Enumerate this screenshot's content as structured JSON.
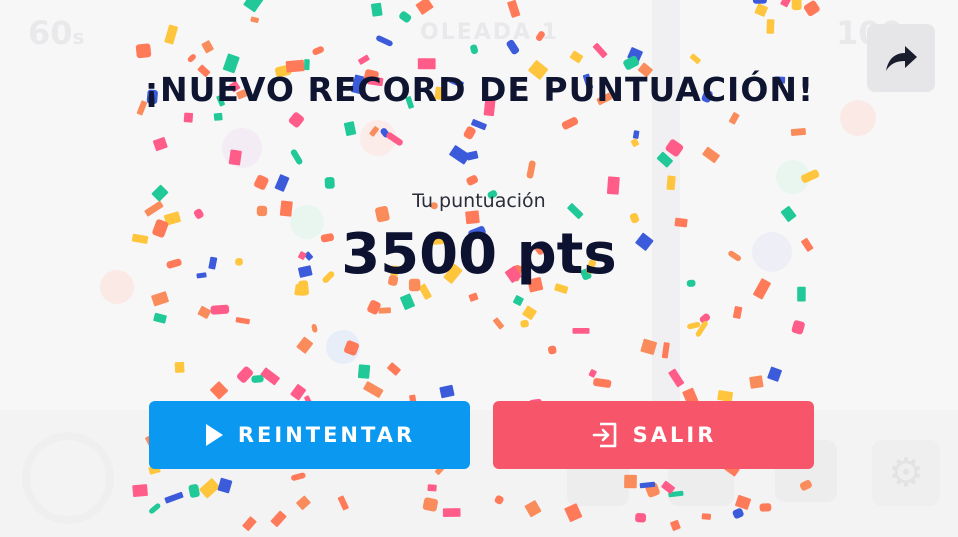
{
  "background_hud": {
    "timer": "60",
    "timer_unit": "s",
    "round_label": "OLEADA 1",
    "score": "100"
  },
  "overlay": {
    "title": "¡NUEVO RECORD DE PUNTUACIÓN!",
    "score_label": "Tu puntuación",
    "score_value": "3500 pts"
  },
  "buttons": {
    "retry_label": "REINTENTAR",
    "exit_label": "SALIR"
  },
  "icons": {
    "share": "share-arrow-icon",
    "retry": "play-icon",
    "exit": "exit-door-icon",
    "settings": "gear-icon"
  },
  "colors": {
    "retry": "#0a98f0",
    "exit": "#f7566a",
    "title": "#0f1530",
    "confetti": [
      "#ff7a59",
      "#3b5bdb",
      "#ffc53d",
      "#20c997",
      "#ff5c8a",
      "#fa8c5c"
    ]
  }
}
